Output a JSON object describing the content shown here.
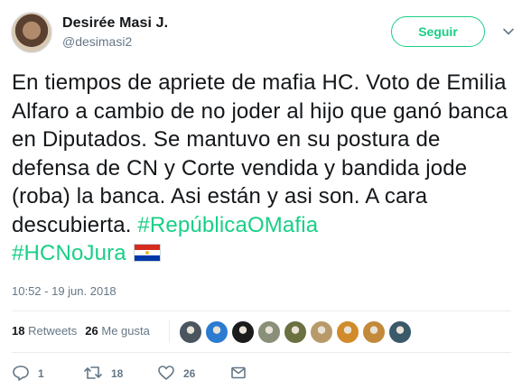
{
  "author": {
    "name": "Desirée Masi J.",
    "handle": "@desimasi2"
  },
  "follow_label": "Seguir",
  "tweet": {
    "text_plain": "En tiempos de apriete de mafia HC. Voto de Emilia Alfaro a cambio de no joder al hijo que ganó banca en Diputados. Se mantuvo en su postura de defensa de CN y Corte vendida y bandida jode (roba) la banca. Asi están y asi son. A cara descubierta. ",
    "hashtag1": "#RepúblicaOMafia",
    "hashtag2": "#HCNoJura",
    "flag_icon": "paraguay-flag-icon"
  },
  "timestamp": "10:52 - 19 jun. 2018",
  "stats": {
    "retweets_count": "18",
    "retweets_label": "Retweets",
    "likes_count": "26",
    "likes_label": "Me gusta"
  },
  "likers": [
    {
      "color": "#4a5560"
    },
    {
      "color": "#2b7bd1"
    },
    {
      "color": "#1b1b1b"
    },
    {
      "color": "#8a8f7a"
    },
    {
      "color": "#6a7040"
    },
    {
      "color": "#b89a6a"
    },
    {
      "color": "#d18b2a"
    },
    {
      "color": "#c28a3a"
    },
    {
      "color": "#3a5a6a"
    }
  ],
  "actions": {
    "reply_count": "1",
    "retweet_count": "18",
    "like_count": "26"
  },
  "colors": {
    "accent": "#19cf86",
    "text": "#14171a",
    "muted": "#657786"
  }
}
